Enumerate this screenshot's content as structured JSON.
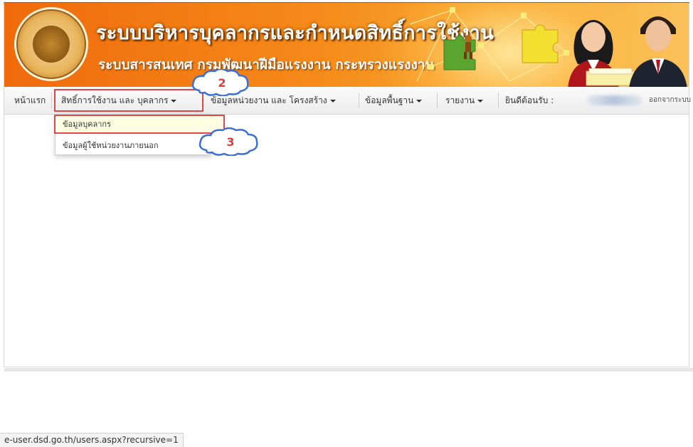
{
  "header": {
    "title": "ระบบบริหารบุคลากรและกำหนดสิทธิ์การใช้งาน",
    "subtitle": "ระบบสารสนเทศ กรมพัฒนาฝีมือแรงงาน กระทรวงแรงงาน",
    "logo_icon": "department-seal-logo"
  },
  "nav": {
    "home": "หน้าแรก",
    "permissions": "สิทธิ์การใช้งาน และ บุคลากร",
    "units": "ข้อมูลหน่วยงาน และ โครงสร้าง",
    "basic": "ข้อมูลพื้นฐาน",
    "reports": "รายงาน",
    "welcome": "ยินดีต้อนรับ :",
    "logout": "ออกจากระบบ"
  },
  "dropdown": {
    "items": [
      "ข้อมูลบุคลากร",
      "ข้อมูลผู้ใช้หน่วยงานภายนอก"
    ]
  },
  "annotations": {
    "step2": "2",
    "step3": "3",
    "highlight_color": "#e04848",
    "cloud_color": "#3a6fd8"
  },
  "status_bar": {
    "url": "e-user.dsd.go.th/users.aspx?recursive=1"
  },
  "colors": {
    "banner_orange": "#f58a19",
    "navbar_bg": "#efefef",
    "dropdown_active_bg": "#fffde1"
  }
}
